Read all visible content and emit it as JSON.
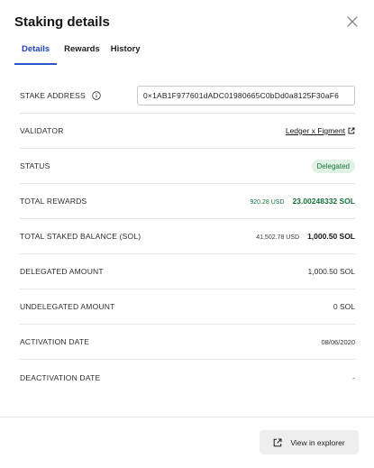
{
  "dialog": {
    "title": "Staking details",
    "close_icon": "close-icon"
  },
  "tabs": [
    {
      "label": "Details",
      "active": true
    },
    {
      "label": "Rewards",
      "active": false
    },
    {
      "label": "History",
      "active": false
    }
  ],
  "fields": {
    "stake_address": {
      "label": "STAKE ADDRESS",
      "icon": "info-icon",
      "value": "0×1AB1F977601dADC01980665C0bDd0a8125F30aF6"
    },
    "validator": {
      "label": "VALIDATOR",
      "value": "Ledger x Figment",
      "icon": "external-link-icon"
    },
    "status": {
      "label": "STATUS",
      "value": "Delegated"
    },
    "total_rewards": {
      "label": "TOTAL REWARDS",
      "usd": "920.28 USD",
      "sol": "23.00248332 SOL"
    },
    "total_staked": {
      "label": "TOTAL STAKED BALANCE (SOL)",
      "usd": "41,502.78 USD",
      "sol": "1,000.50 SOL"
    },
    "delegated": {
      "label": "DELEGATED AMOUNT",
      "value": "1,000.50 SOL"
    },
    "undelegated": {
      "label": "UNDELEGATED AMOUNT",
      "value": "0 SOL"
    },
    "activation": {
      "label": "ACTIVATION DATE",
      "value": "08/06/2020"
    },
    "deactivation": {
      "label": "DEACTIVATION DATE",
      "value": "-"
    }
  },
  "footer": {
    "explorer_label": "View in explorer",
    "explorer_icon": "external-link-icon"
  },
  "colors": {
    "accent": "#2b56c9",
    "success": "#17733a",
    "badge_bg": "#dff2e3"
  }
}
